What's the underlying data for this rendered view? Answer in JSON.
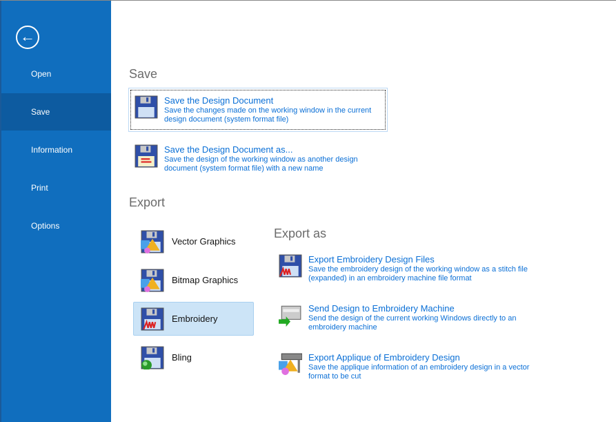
{
  "sidebar": {
    "back_icon": "arrow-left-circle-icon",
    "items": [
      {
        "label": "Open"
      },
      {
        "label": "Save",
        "selected": true
      },
      {
        "label": "Information"
      },
      {
        "label": "Print"
      },
      {
        "label": "Options"
      }
    ]
  },
  "save": {
    "heading": "Save",
    "items": [
      {
        "title": "Save the Design Document",
        "desc1": "Save the changes made on the working window in the current",
        "desc2": "design document (system format file)",
        "icon": "floppy-icon"
      },
      {
        "title": "Save the Design Document as...",
        "desc1": "Save the design of the working window as another design",
        "desc2": "document (system format file) with a new name",
        "icon": "floppy-save-as-icon"
      }
    ]
  },
  "export": {
    "heading": "Export",
    "items": [
      {
        "label": "Vector Graphics",
        "icon": "vector-graphics-icon"
      },
      {
        "label": "Bitmap Graphics",
        "icon": "bitmap-graphics-icon"
      },
      {
        "label": "Embroidery",
        "icon": "embroidery-icon",
        "selected": true
      },
      {
        "label": "Bling",
        "icon": "bling-icon"
      }
    ]
  },
  "export_as": {
    "heading": "Export as",
    "items": [
      {
        "title": "Export Embroidery Design Files",
        "desc1": "Save the embroidery design of the working window as a stitch file",
        "desc2": "(expanded) in an embroidery machine file format"
      },
      {
        "title": "Send Design to Embroidery Machine",
        "desc1": "Send the design of the current working Windows directly to an",
        "desc2": "embroidery machine"
      },
      {
        "title": "Export Applique of Embroidery Design",
        "desc1": "Save the applique information of an embroidery design in a vector",
        "desc2": "format to be cut"
      }
    ]
  },
  "colors": {
    "sidebar": "#106ebe",
    "sidebar_selected": "#0d5ba0",
    "link": "#0a6fd6",
    "selected_bg": "#cce4f7"
  }
}
